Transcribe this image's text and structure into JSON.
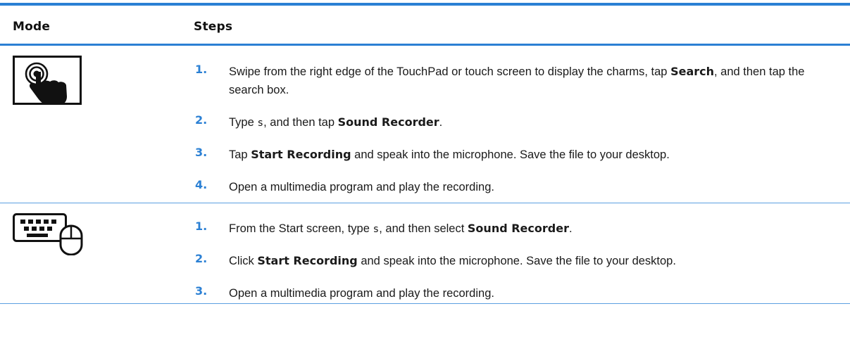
{
  "table": {
    "headers": {
      "mode": "Mode",
      "steps": "Steps"
    },
    "rows": [
      {
        "mode_icon": "touch-tap-icon",
        "steps": [
          {
            "num": "1.",
            "p0": "Swipe from the right edge of the TouchPad or touch screen to display the charms, tap ",
            "b0": "Search",
            "p1": ", and then tap the search box."
          },
          {
            "num": "2.",
            "p0": "Type ",
            "code": "s",
            "p1": ", and then tap ",
            "b0": "Sound Recorder",
            "p2": "."
          },
          {
            "num": "3.",
            "p0": "Tap ",
            "b0": "Start Recording",
            "p1": " and speak into the microphone. Save the file to your desktop."
          },
          {
            "num": "4.",
            "p0": "Open a multimedia program and play the recording."
          }
        ]
      },
      {
        "mode_icon": "keyboard-mouse-icon",
        "steps": [
          {
            "num": "1.",
            "p0": "From the Start screen, type ",
            "code": "s",
            "p1": ", and then select ",
            "b0": "Sound Recorder",
            "p2": "."
          },
          {
            "num": "2.",
            "p0": "Click ",
            "b0": "Start Recording",
            "p1": " and speak into the microphone. Save the file to your desktop."
          },
          {
            "num": "3.",
            "p0": "Open a multimedia program and play the recording."
          }
        ]
      }
    ]
  }
}
